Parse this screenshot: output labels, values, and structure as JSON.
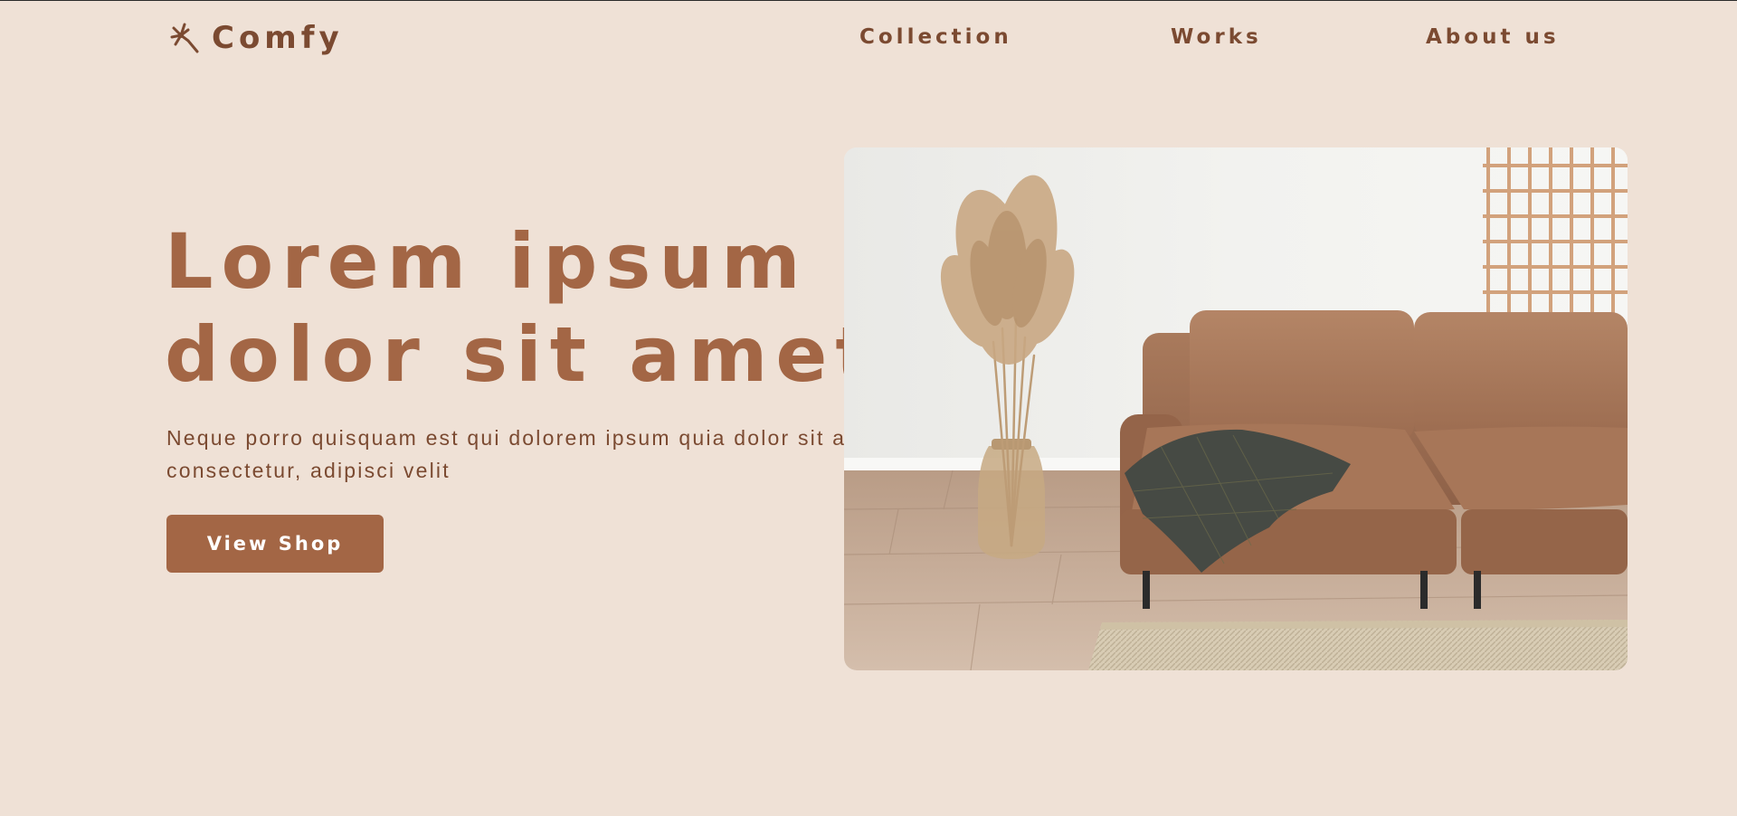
{
  "header": {
    "logo_text": "Comfy",
    "logo_icon": "flower-icon",
    "nav": [
      {
        "label": "Collection"
      },
      {
        "label": "Works"
      },
      {
        "label": "About us"
      }
    ]
  },
  "hero": {
    "title_line1": "Lorem ipsum",
    "title_line2": "dolor sit amet",
    "subtitle": "Neque porro quisquam est qui dolorem ipsum quia dolor sit amet, consectetur, adipisci velit",
    "button_label": "View Shop",
    "image": "sofa-photo"
  },
  "colors": {
    "background": "#EFE1D6",
    "accent": "#A36645",
    "text_dark": "#7B4A31",
    "button_text": "#FFFFFF"
  }
}
